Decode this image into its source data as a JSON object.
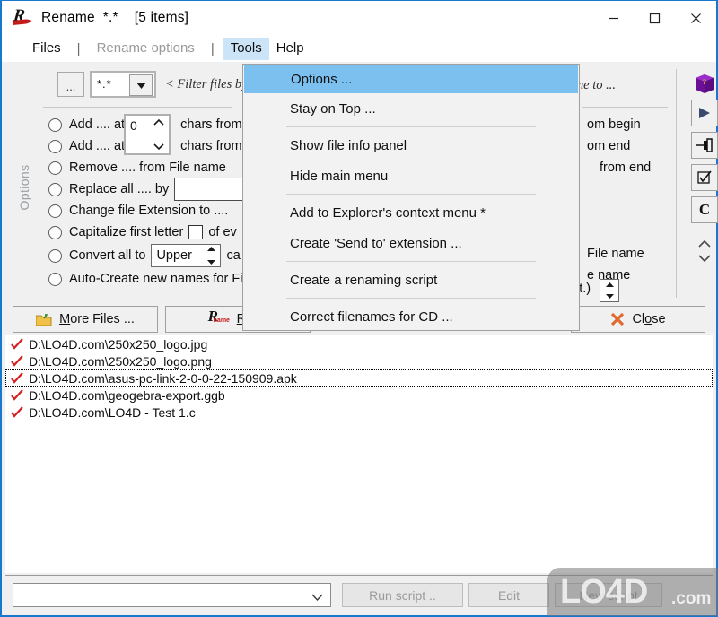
{
  "window": {
    "title": "Rename  *.*    [5 items]",
    "app_icon": "rename-app-icon",
    "minimize_label": "–",
    "maximize_label": "□",
    "close_label": "✕"
  },
  "menubar": {
    "items": [
      {
        "label": "Files",
        "state": "normal"
      },
      {
        "label": "|",
        "state": "separator"
      },
      {
        "label": "Rename options",
        "state": "disabled"
      },
      {
        "label": "|",
        "state": "separator"
      },
      {
        "label": "Tools",
        "state": "active"
      },
      {
        "label": "Help",
        "state": "normal"
      }
    ]
  },
  "tools_menu": {
    "items": [
      {
        "label": "Options ...",
        "highlight": true
      },
      {
        "label": "Stay on Top ...",
        "highlight": false
      },
      {
        "separator": true
      },
      {
        "label": "Show file info panel",
        "highlight": false
      },
      {
        "label": "Hide main menu",
        "highlight": false
      },
      {
        "separator": true
      },
      {
        "label": "Add to Explorer's context menu *",
        "highlight": false
      },
      {
        "label": "Create 'Send to' extension ...",
        "highlight": false
      },
      {
        "separator": true
      },
      {
        "label": "Create a renaming script",
        "highlight": false
      },
      {
        "separator": true
      },
      {
        "label": "Correct filenames for CD ...",
        "highlight": false
      }
    ],
    "highlight_color": "#7cc0ef"
  },
  "options_panel": {
    "group_label": "Options",
    "browse_button": "...",
    "filter_value": "*.*",
    "filter_hint": "< Filter files by...",
    "rename_to_hint": "name to ...",
    "rows": [
      {
        "label": "Add .... at",
        "suffix": "chars from",
        "right": "om begin",
        "has_spinner": true,
        "spinner_value": "0"
      },
      {
        "label": "Add .... at",
        "suffix": "chars from",
        "right": "om  end",
        "has_spinner": false
      },
      {
        "label": "Remove .... from File name",
        "right": "from end"
      },
      {
        "label": "Replace all .... by",
        "right": "",
        "has_textbox": true,
        "textbox_value": ""
      },
      {
        "label": "Change file Extension to ....",
        "right": ""
      },
      {
        "label": "Capitalize first letter",
        "suffix": "of ev",
        "right": "",
        "has_checkbox": true
      },
      {
        "label": "Convert all to",
        "suffix": "ca",
        "right": "File name",
        "has_case_combo": true,
        "case_value": "Upper"
      },
      {
        "label": "Auto-Create new names for Fi",
        "right": "e name"
      }
    ],
    "ext_label": "xt.)",
    "tool_buttons": [
      {
        "name": "book-icon",
        "label": ""
      },
      {
        "name": "play-button",
        "label": "▶"
      },
      {
        "name": "pin-button",
        "label": "pin"
      },
      {
        "name": "check-button",
        "label": "check"
      },
      {
        "name": "clear-button",
        "label": "C"
      }
    ],
    "nav_up": "∧",
    "nav_down": "∨"
  },
  "action_buttons": {
    "more_files": "More Files ...",
    "more_files_mnemonic": "M",
    "rename": "Rena",
    "rename_mnemonic": "R",
    "close": "Close",
    "close_mnemonic": "o"
  },
  "file_list": {
    "items": [
      {
        "path": "D:\\LO4D.com\\250x250_logo.jpg",
        "checked": true,
        "focused": false
      },
      {
        "path": "D:\\LO4D.com\\250x250_logo.png",
        "checked": true,
        "focused": false
      },
      {
        "path": "D:\\LO4D.com\\asus-pc-link-2-0-0-22-150909.apk",
        "checked": true,
        "focused": true
      },
      {
        "path": "D:\\LO4D.com\\geogebra-export.ggb",
        "checked": true,
        "focused": false
      },
      {
        "path": "D:\\LO4D.com\\LO4D - Test 1.c",
        "checked": true,
        "focused": false
      }
    ]
  },
  "bottom_bar": {
    "script_combo_value": "",
    "buttons": [
      {
        "label": "Run script ..",
        "disabled": true
      },
      {
        "label": "Edit",
        "disabled": true
      },
      {
        "label": "New script",
        "disabled": true
      }
    ]
  },
  "watermark": {
    "text": "LO4D",
    "suffix": ".com"
  },
  "colors": {
    "window_border": "#1878d0",
    "menu_active_bg": "#cce4f7",
    "menu_highlight": "#7cc0ef",
    "panel_bg": "#f0f0f0",
    "check_red": "#d42020"
  }
}
